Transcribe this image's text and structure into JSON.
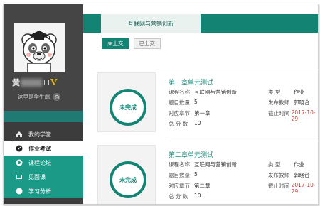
{
  "user": {
    "name_prefix": "黄",
    "vip": "V",
    "signature": "这里是学生端"
  },
  "nav": {
    "items": [
      {
        "label": "我的学堂",
        "icon": "home-icon"
      },
      {
        "label": "作业考试",
        "icon": "pencil-icon"
      },
      {
        "label": "课程论坛",
        "icon": "forum-icon"
      },
      {
        "label": "见面课",
        "icon": "video-icon"
      },
      {
        "label": "学习分析",
        "icon": "chart-icon"
      }
    ]
  },
  "header": {
    "course_tab": "互联网与营销创新"
  },
  "filters": {
    "not_submitted": "未上交",
    "submitted": "已上交"
  },
  "labels": {
    "course_name": "课程名称",
    "question_count": "题目数量",
    "chapter": "对应章节",
    "total_score": "总  分  数",
    "type": "类  型",
    "publisher": "发布教师",
    "deadline": "截止时间"
  },
  "cards": [
    {
      "title": "第一章单元测试",
      "status": "未完成",
      "course_name": "互联网与营销创新",
      "question_count": "5",
      "chapter": "第一章",
      "total_score": "10",
      "type": "作业",
      "publisher": "郭晓合",
      "deadline": "2017-10-29"
    },
    {
      "title": "第二章单元测试",
      "status": "未完成",
      "course_name": "互联网与营销创新",
      "question_count": "5",
      "chapter": "第二章",
      "total_score": "10",
      "type": "作业",
      "publisher": "郭晓合",
      "deadline": "2017-10-29"
    }
  ],
  "colors": {
    "accent": "#138474",
    "sidebar": "#3c3c3c",
    "deadline": "#d9332b",
    "vip": "#e6b122"
  }
}
